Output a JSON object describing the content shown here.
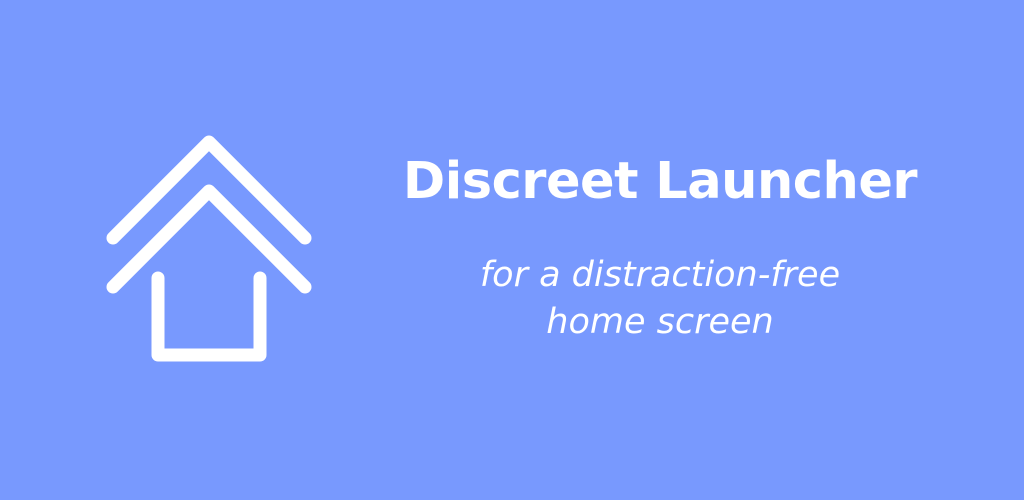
{
  "banner": {
    "background_color": "#7899FE",
    "icon": "home-outline-icon",
    "icon_color": "#FFFFFF",
    "title": "Discreet Launcher",
    "tagline_line1": "for a distraction-free",
    "tagline_line2": "home screen"
  }
}
